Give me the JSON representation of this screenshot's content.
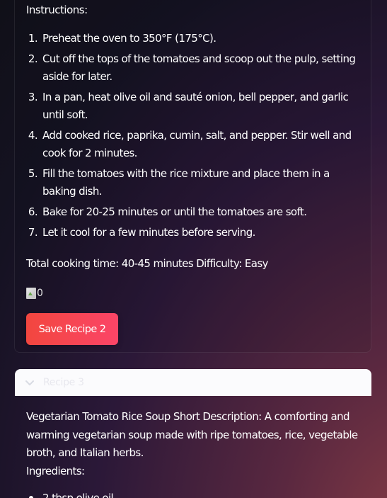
{
  "instructions": {
    "heading": "Instructions:",
    "steps": [
      {
        "num": "1.",
        "text": "Preheat the oven to 350°F (175°C)."
      },
      {
        "num": "2.",
        "text": "Cut off the tops of the tomatoes and scoop out the pulp, setting aside for later."
      },
      {
        "num": "3.",
        "text": "In a pan, heat olive oil and sauté onion, bell pepper, and garlic until soft."
      },
      {
        "num": "4.",
        "text": "Add cooked rice, paprika, cumin, salt, and pepper. Stir well and cook for 2 minutes."
      },
      {
        "num": "5.",
        "text": "Fill the tomatoes with the rice mixture and place them in a baking dish."
      },
      {
        "num": "6.",
        "text": "Bake for 20-25 minutes or until the tomatoes are soft."
      },
      {
        "num": "7.",
        "text": "Let it cool for a few minutes before serving."
      }
    ]
  },
  "summary": {
    "total_time": "Total cooking time: 40-45 minutes Difficulty: Easy"
  },
  "image": {
    "alt": "0",
    "icon": "broken-image-icon"
  },
  "save_button": {
    "label": "Save Recipe 2"
  },
  "recipe3": {
    "header_label": "Recipe 3",
    "header_icon": "chevron-down-icon",
    "description": "Vegetarian Tomato Rice Soup Short Description: A comforting and warming vegetarian soup made with ripe tomatoes, rice, vegetable broth, and Italian herbs.",
    "ingredients_heading": "Ingredients:",
    "first_ingredient_partial": "2 tbsp olive oil"
  },
  "colors": {
    "button_gradient_start": "#f2463f",
    "button_gradient_end": "#fb4567",
    "header_bg": "#fbfbfd"
  }
}
